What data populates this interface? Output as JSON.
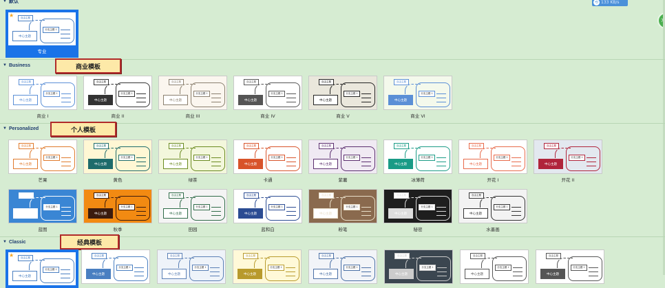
{
  "sections": {
    "default": {
      "label": "默认"
    },
    "business": {
      "label": "Business",
      "callout": "商业模板"
    },
    "personalized": {
      "label": "Personalized",
      "callout": "个人模板"
    },
    "classic": {
      "label": "Classic",
      "callout": "经典模板"
    }
  },
  "status": {
    "speed": "133 KB/s",
    "float_label": "7"
  },
  "mini": {
    "central": "中心主题",
    "sub": "分支主题 1",
    "tag": "自由主题",
    "leaf": "子主题 1"
  },
  "templates": {
    "default": [
      {
        "name": "专业",
        "accent": "#4a7fc1",
        "bg": "#ffffff"
      }
    ],
    "business": [
      {
        "name": "商业 I",
        "accent": "#5b8fd6",
        "bg": "#ffffff"
      },
      {
        "name": "商业 II",
        "accent": "#333333",
        "bg": "#ffffff"
      },
      {
        "name": "商业 III",
        "accent": "#8a7f6e",
        "bg": "#fbf6ef"
      },
      {
        "name": "商业 IV",
        "accent": "#555555",
        "bg": "#ffffff"
      },
      {
        "name": "商业 V",
        "accent": "#222222",
        "bg": "#eae7dc"
      },
      {
        "name": "商业 VI",
        "accent": "#5b8fd6",
        "bg": "#f4f9ec"
      }
    ],
    "personalized_row1": [
      {
        "name": "芒果",
        "accent": "#e07a2c",
        "bg": "#ffffff"
      },
      {
        "name": "黄色",
        "accent": "#1d6b6b",
        "bg": "#fff7d4"
      },
      {
        "name": "绿茶",
        "accent": "#6a8a1f",
        "bg": "#f3f7dc"
      },
      {
        "name": "卡通",
        "accent": "#d8532a",
        "bg": "#ffffff"
      },
      {
        "name": "紫薯",
        "accent": "#5a2d6e",
        "bg": "#f0eaf3"
      },
      {
        "name": "冰薄荷",
        "accent": "#1a9b86",
        "bg": "#ffffff"
      },
      {
        "name": "开花 I",
        "accent": "#e86a4a",
        "bg": "#ffffff"
      },
      {
        "name": "开花 II",
        "accent": "#b0243a",
        "bg": "#e3e8ef"
      }
    ],
    "personalized_row2": [
      {
        "name": "蓝图",
        "accent": "#ffffff",
        "bg": "#3a86d4"
      },
      {
        "name": "秋季",
        "accent": "#3b1b0e",
        "bg": "#f28a12"
      },
      {
        "name": "田园",
        "accent": "#2f6b48",
        "bg": "#f4f4f4"
      },
      {
        "name": "蓝和白",
        "accent": "#2b4c93",
        "bg": "#ffffff"
      },
      {
        "name": "粉笔",
        "accent": "#e9dfc9",
        "bg": "#8a6a4e"
      },
      {
        "name": "秘密",
        "accent": "#dddddd",
        "bg": "#1e1e1e"
      },
      {
        "name": "水墨画",
        "accent": "#333333",
        "bg": "#f3f3f3"
      }
    ],
    "classic": [
      {
        "accent": "#4a7fc1",
        "bg": "#ffffff"
      },
      {
        "accent": "#4a7fc1",
        "bg": "#ffffff"
      },
      {
        "accent": "#5a7fb5",
        "bg": "#eef3f9"
      },
      {
        "accent": "#b89a2c",
        "bg": "#fff9d8"
      },
      {
        "accent": "#4a6fa5",
        "bg": "#f2f4f8"
      },
      {
        "accent": "#cccccc",
        "bg": "#3b4650"
      },
      {
        "accent": "#555555",
        "bg": "#ffffff"
      },
      {
        "accent": "#555555",
        "bg": "#ffffff"
      }
    ]
  }
}
